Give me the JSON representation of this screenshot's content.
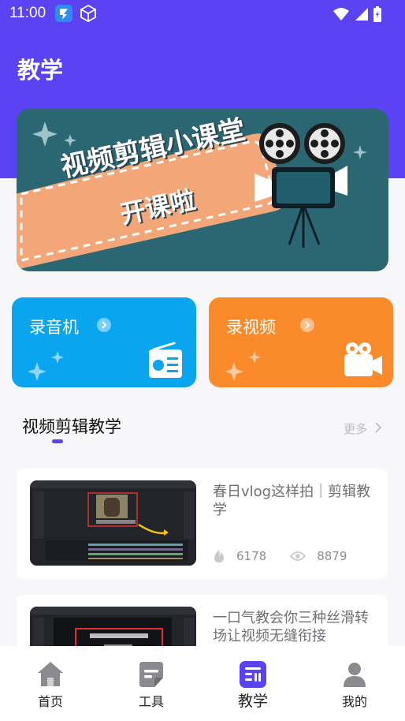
{
  "status_bar": {
    "time": "11:00"
  },
  "header": {
    "title": "教学"
  },
  "banner": {
    "line1": "视频剪辑小课堂",
    "line2": "开课啦"
  },
  "cards": [
    {
      "label": "录音机",
      "icon": "radio-icon",
      "color": "#0aa5ef"
    },
    {
      "label": "录视频",
      "icon": "video-camera-icon",
      "color": "#fb8a2a"
    }
  ],
  "section": {
    "title": "视频剪辑教学",
    "more": "更多"
  },
  "videos": [
    {
      "title": "春日vlog这样拍｜剪辑教学",
      "likes": "6178",
      "views": "8879"
    },
    {
      "title": "一口气教会你三种丝滑转场让视频无缝衔接"
    }
  ],
  "nav": [
    {
      "label": "首页",
      "icon": "home-icon"
    },
    {
      "label": "工具",
      "icon": "tools-icon"
    },
    {
      "label": "教学",
      "icon": "tutorial-icon",
      "active": true
    },
    {
      "label": "我的",
      "icon": "profile-icon"
    }
  ],
  "colors": {
    "accent": "#5b43f3",
    "card_audio": "#0aa5ef",
    "card_video": "#fb8a2a"
  }
}
